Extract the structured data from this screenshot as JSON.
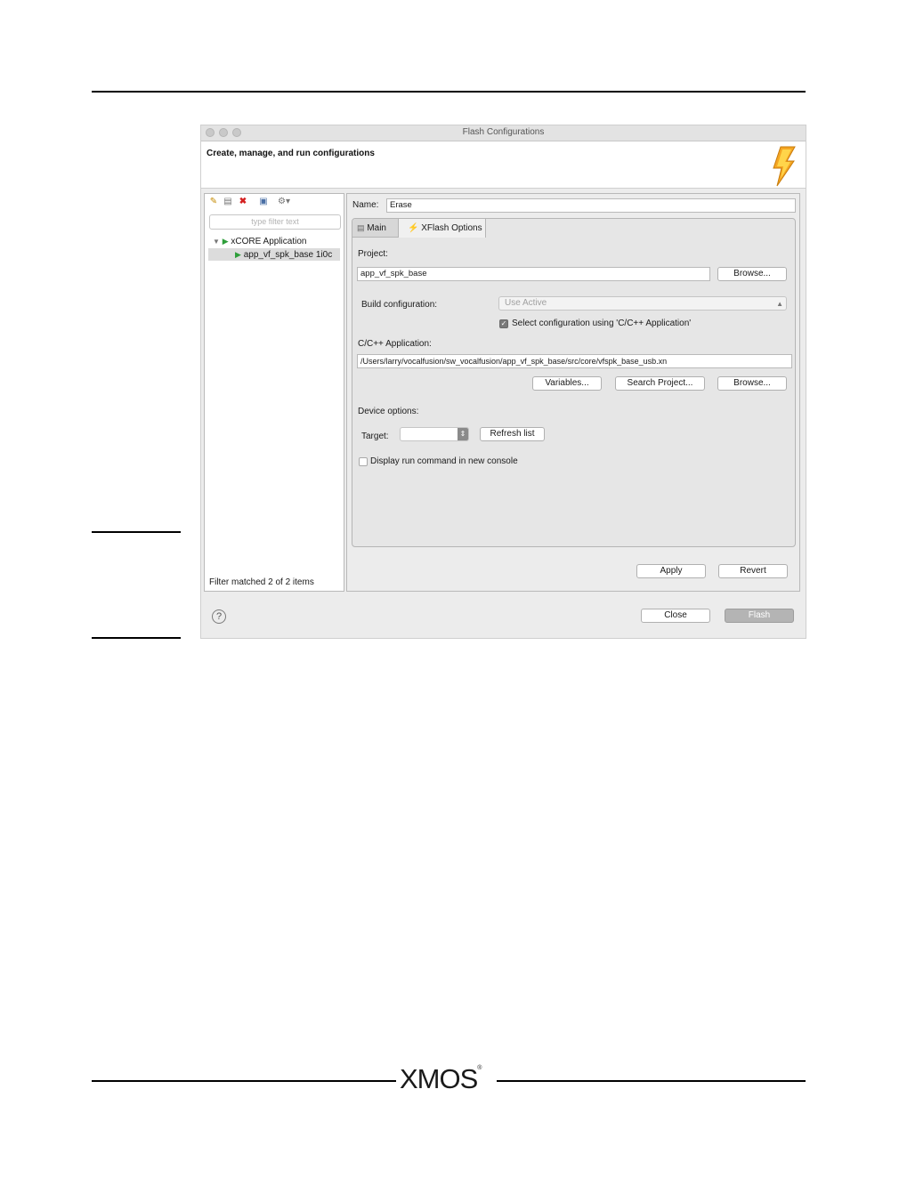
{
  "window": {
    "title": "Flash Configurations",
    "header": "Create, manage, and run configurations"
  },
  "left": {
    "filter_placeholder": "type filter text",
    "tree": [
      {
        "label": "xCORE Application"
      },
      {
        "label": "app_vf_spk_base 1i0c"
      }
    ],
    "status": "Filter matched 2 of 2 items"
  },
  "right": {
    "name_label": "Name:",
    "name_value": "Erase",
    "tabs": [
      {
        "label": "Main"
      },
      {
        "label": "XFlash Options"
      }
    ],
    "project_label": "Project:",
    "project_value": "app_vf_spk_base",
    "browse_label": "Browse...",
    "build_config_label": "Build configuration:",
    "build_config_value": "Use Active",
    "select_config_label": "Select configuration using 'C/C++ Application'",
    "app_label": "C/C++ Application:",
    "app_value": "/Users/larry/vocalfusion/sw_vocalfusion/app_vf_spk_base/src/core/vfspk_base_usb.xn",
    "variables_label": "Variables...",
    "search_project_label": "Search Project...",
    "browse2_label": "Browse...",
    "device_options_label": "Device options:",
    "target_label": "Target:",
    "refresh_label": "Refresh list",
    "display_run_label": "Display run command in new console",
    "apply_label": "Apply",
    "revert_label": "Revert"
  },
  "footer": {
    "close_label": "Close",
    "flash_label": "Flash"
  },
  "doc": {
    "logo": "XMOS"
  },
  "colors": {
    "accent_bolt": "#f5a623",
    "selection": "#dcdcdc",
    "run_green": "#2e9e3a",
    "delete_red": "#d42020"
  }
}
